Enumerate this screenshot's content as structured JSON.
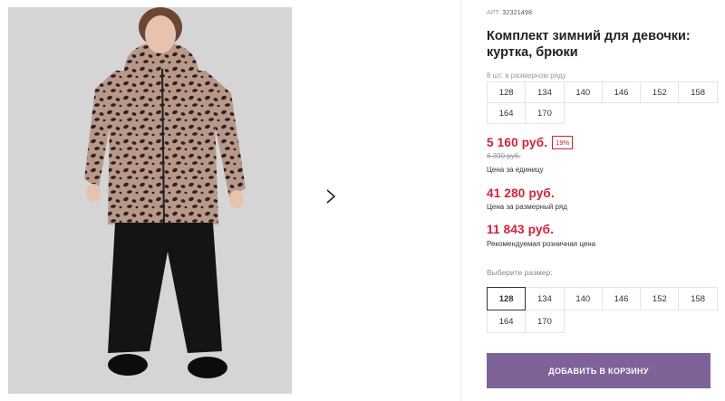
{
  "gallery": {
    "image_alt": "Комплект зимний для девочки: куртка, брюки",
    "next_icon": "chevron-right-icon"
  },
  "product": {
    "sku_label": "АРТ.",
    "sku": "32321498",
    "title": "Комплект зимний для девочки: куртка, брюки",
    "pack_label": "8 шт. в размерном ряду",
    "pack_sizes": [
      "128",
      "134",
      "140",
      "146",
      "152",
      "158",
      "164",
      "170"
    ]
  },
  "prices": {
    "unit_price": "5 160 руб.",
    "discount": "19%",
    "old_price": "6 390 руб.",
    "unit_caption": "Цена за единицу",
    "row_price": "41 280 руб.",
    "row_caption": "Цена за размерный ряд",
    "retail_price": "11 843 руб.",
    "retail_caption": "Рекомендуемая розничная цена"
  },
  "size_select": {
    "label": "Выберите размер:",
    "options": [
      "128",
      "134",
      "140",
      "146",
      "152",
      "158",
      "164",
      "170"
    ],
    "selected": "128"
  },
  "cart": {
    "button_label": "ДОБАВИТЬ В КОРЗИНУ"
  },
  "colors": {
    "accent": "#7e6399",
    "price_red": "#d72036"
  }
}
